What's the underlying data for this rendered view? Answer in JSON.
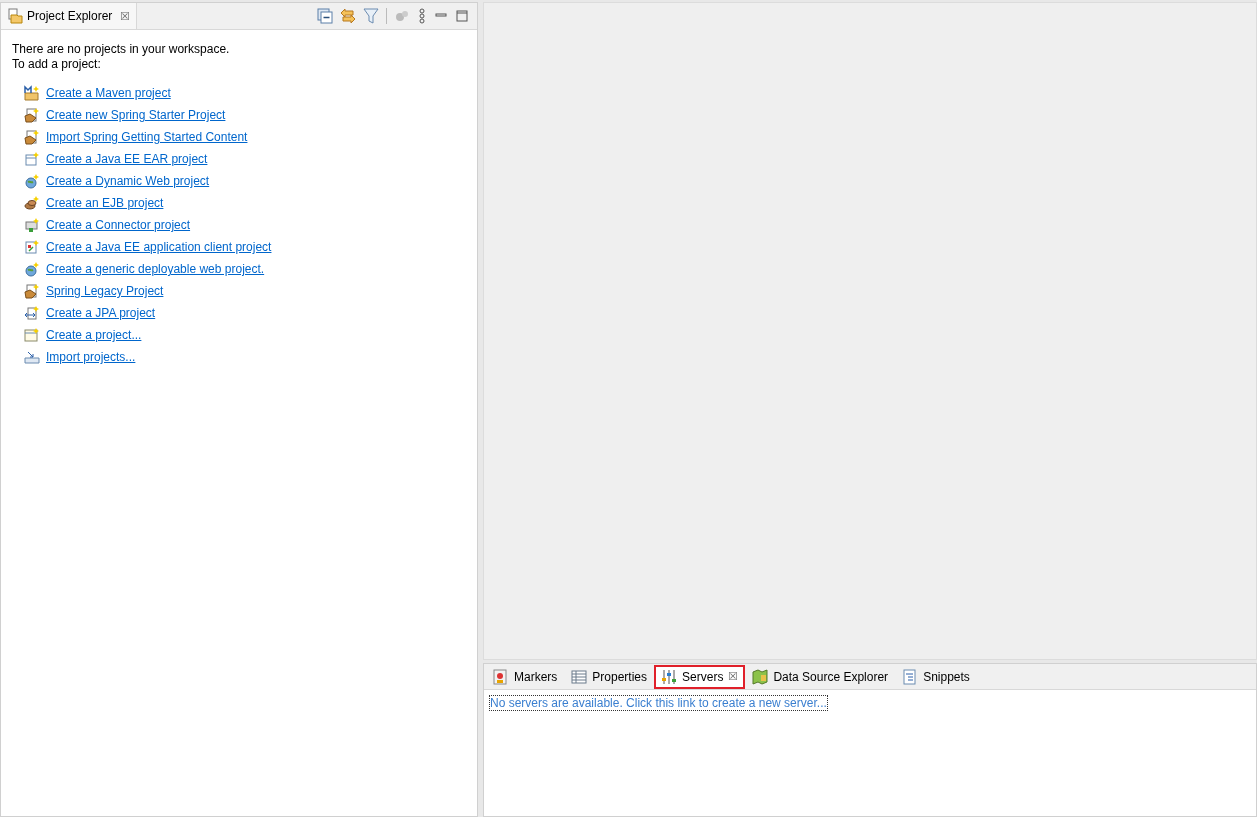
{
  "explorer": {
    "tab": {
      "title": "Project Explorer",
      "close": "☒"
    },
    "message": [
      "There are no projects in your workspace.",
      "To add a project:"
    ],
    "links": [
      {
        "kind": "maven",
        "label": "Create a Maven project"
      },
      {
        "kind": "spring",
        "label": "Create new Spring Starter Project"
      },
      {
        "kind": "spring",
        "label": "Import Spring Getting Started Content"
      },
      {
        "kind": "ear",
        "label": "Create a Java EE EAR project"
      },
      {
        "kind": "globe",
        "label": "Create a Dynamic Web project"
      },
      {
        "kind": "ejb",
        "label": "Create an EJB project"
      },
      {
        "kind": "connector",
        "label": "Create a Connector project"
      },
      {
        "kind": "client",
        "label": "Create a Java EE application client project"
      },
      {
        "kind": "globe",
        "label": "Create a generic deployable web project."
      },
      {
        "kind": "spring",
        "label": "Spring Legacy Project"
      },
      {
        "kind": "jpa",
        "label": "Create a JPA project"
      },
      {
        "kind": "project",
        "label": "Create a project..."
      },
      {
        "kind": "import",
        "label": "Import projects..."
      }
    ]
  },
  "bottom_panel": {
    "tabs": [
      {
        "kind": "markers",
        "label": "Markers",
        "selected": false,
        "highlighted": false
      },
      {
        "kind": "properties",
        "label": "Properties",
        "selected": false,
        "highlighted": false
      },
      {
        "kind": "servers",
        "label": "Servers",
        "selected": true,
        "highlighted": true,
        "close": "☒"
      },
      {
        "kind": "datasource",
        "label": "Data Source Explorer",
        "selected": false,
        "highlighted": false
      },
      {
        "kind": "snippets",
        "label": "Snippets",
        "selected": false,
        "highlighted": false
      }
    ],
    "link": "No servers are available. Click this link to create a new server..."
  }
}
